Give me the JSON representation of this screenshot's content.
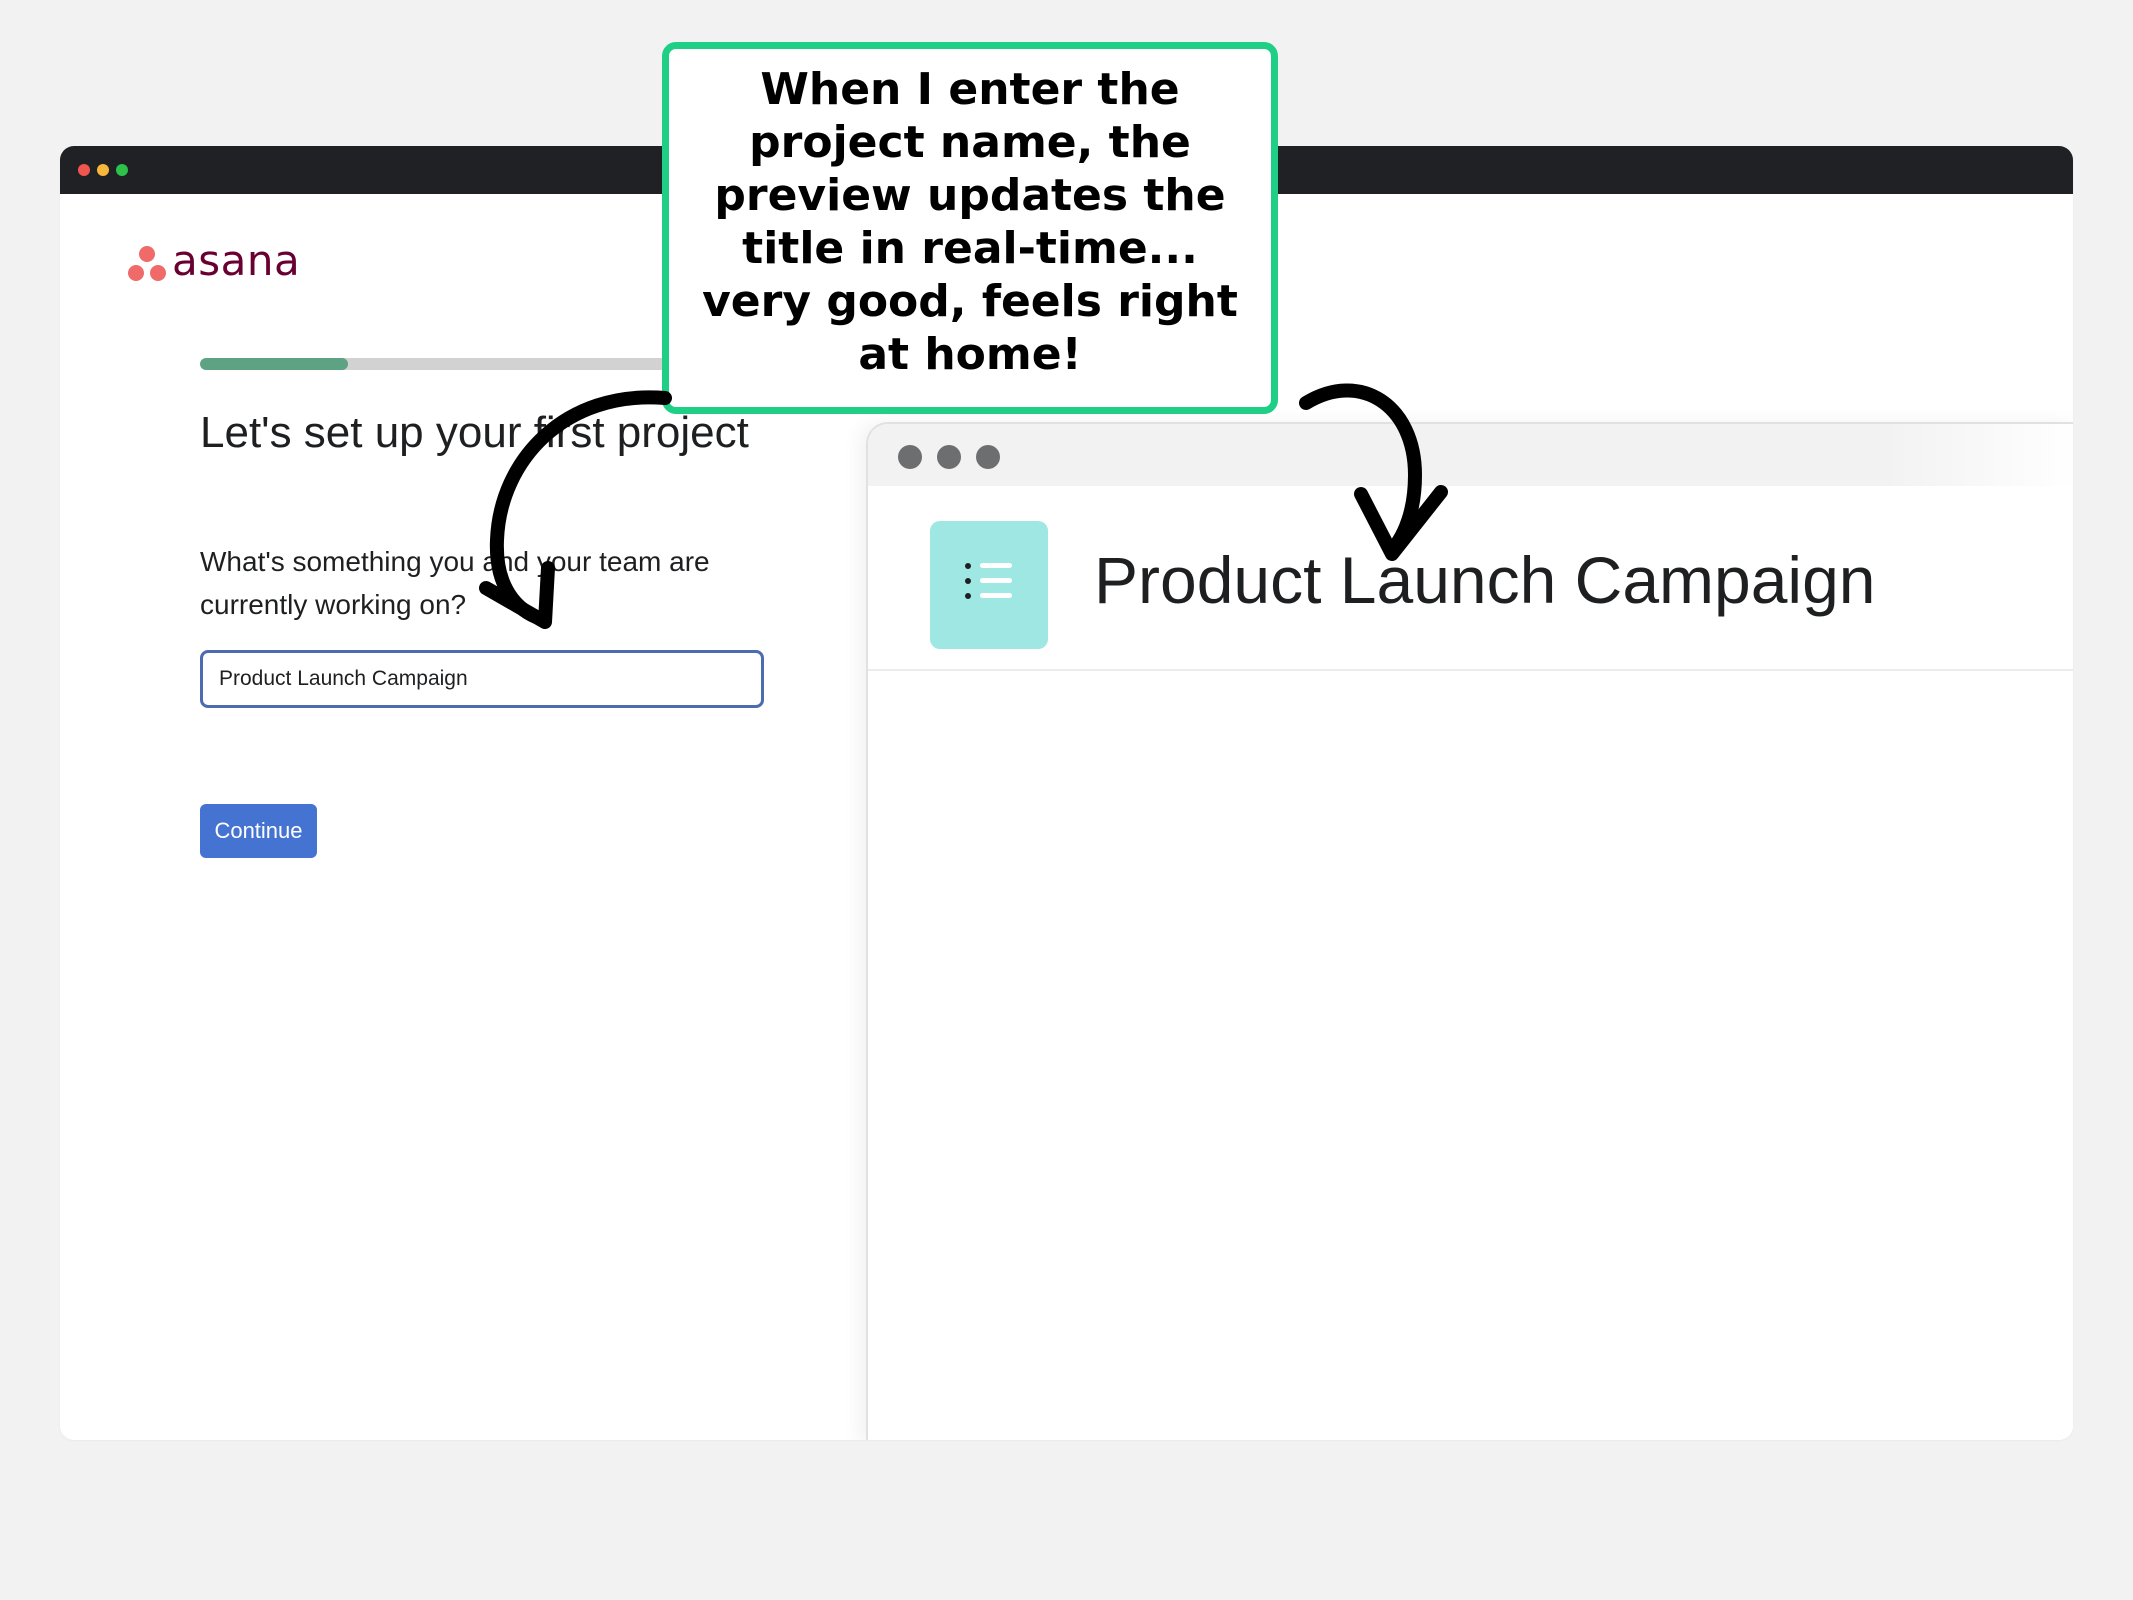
{
  "window": {
    "traffic_lights": [
      "close-dot",
      "minimize-dot",
      "zoom-dot"
    ]
  },
  "logo": {
    "text": "asana"
  },
  "onboarding": {
    "progress": 0.215,
    "heading": "Let's set up your first project",
    "question": "What's something you and your team are currently working on?",
    "input_value": "Product Launch Campaign",
    "continue_label": "Continue"
  },
  "preview": {
    "project_title": "Product Launch Campaign",
    "icon": "list-icon"
  },
  "annotation": {
    "text": "When I enter the project name, the preview updates the title in real-time... very good, feels right at home!"
  },
  "colors": {
    "accent": "#20cf86",
    "button": "#4573d2",
    "progress": "#5da283",
    "brand_dots": "#f06a6a",
    "brand_text": "#690031",
    "project_icon_bg": "#9ee7e3"
  }
}
